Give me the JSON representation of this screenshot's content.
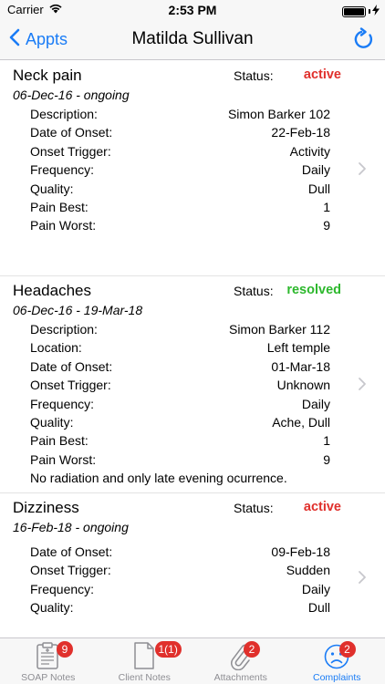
{
  "status_bar": {
    "carrier": "Carrier",
    "time": "2:53 PM",
    "battery_level": 1.0
  },
  "nav": {
    "back_label": "Appts",
    "title": "Matilda Sullivan"
  },
  "complaints": [
    {
      "name": "Neck pain",
      "status_label": "Status:",
      "status": "active",
      "status_color": "#e0302c",
      "dates": "06-Dec-16  -  ongoing",
      "fields": [
        {
          "label": "Description:",
          "value": "Simon Barker 102"
        },
        {
          "label": "Date of Onset:",
          "value": "22-Feb-18"
        },
        {
          "label": "Onset Trigger:",
          "value": "Activity"
        },
        {
          "label": "Frequency:",
          "value": "Daily"
        },
        {
          "label": "Quality:",
          "value": "Dull"
        },
        {
          "label": "Pain Best:",
          "value": "1"
        },
        {
          "label": "Pain Worst:",
          "value": "9"
        }
      ],
      "note": ""
    },
    {
      "name": "Headaches",
      "status_label": "Status:",
      "status": "resolved",
      "status_color": "#2db82d",
      "dates": "06-Dec-16  -  19-Mar-18",
      "fields": [
        {
          "label": "Description:",
          "value": "Simon Barker 112"
        },
        {
          "label": "Location:",
          "value": "Left temple"
        },
        {
          "label": "Date of Onset:",
          "value": "01-Mar-18"
        },
        {
          "label": "Onset Trigger:",
          "value": "Unknown"
        },
        {
          "label": "Frequency:",
          "value": "Daily"
        },
        {
          "label": "Quality:",
          "value": "Ache, Dull"
        },
        {
          "label": "Pain Best:",
          "value": "1"
        },
        {
          "label": "Pain Worst:",
          "value": "9"
        }
      ],
      "note": "No radiation and only late evening ocurrence."
    },
    {
      "name": "Dizziness",
      "status_label": "Status:",
      "status": "active",
      "status_color": "#e0302c",
      "dates": "16-Feb-18  -  ongoing",
      "fields": [
        {
          "label": "Date of Onset:",
          "value": "09-Feb-18"
        },
        {
          "label": "Onset Trigger:",
          "value": "Sudden"
        },
        {
          "label": "Frequency:",
          "value": "Daily"
        },
        {
          "label": "Quality:",
          "value": "Dull"
        }
      ],
      "note": ""
    }
  ],
  "tabs": [
    {
      "label": "SOAP Notes",
      "badge": "9",
      "icon": "clipboard-icon",
      "active": false
    },
    {
      "label": "Client Notes",
      "badge": "1(1)",
      "icon": "document-icon",
      "active": false
    },
    {
      "label": "Attachments",
      "badge": "2",
      "icon": "paperclip-icon",
      "active": false
    },
    {
      "label": "Complaints",
      "badge": "2",
      "icon": "sad-face-icon",
      "active": true
    }
  ],
  "colors": {
    "accent": "#1a7cf6",
    "active": "#e0302c",
    "resolved": "#2db82d",
    "badge": "#e0302c"
  }
}
